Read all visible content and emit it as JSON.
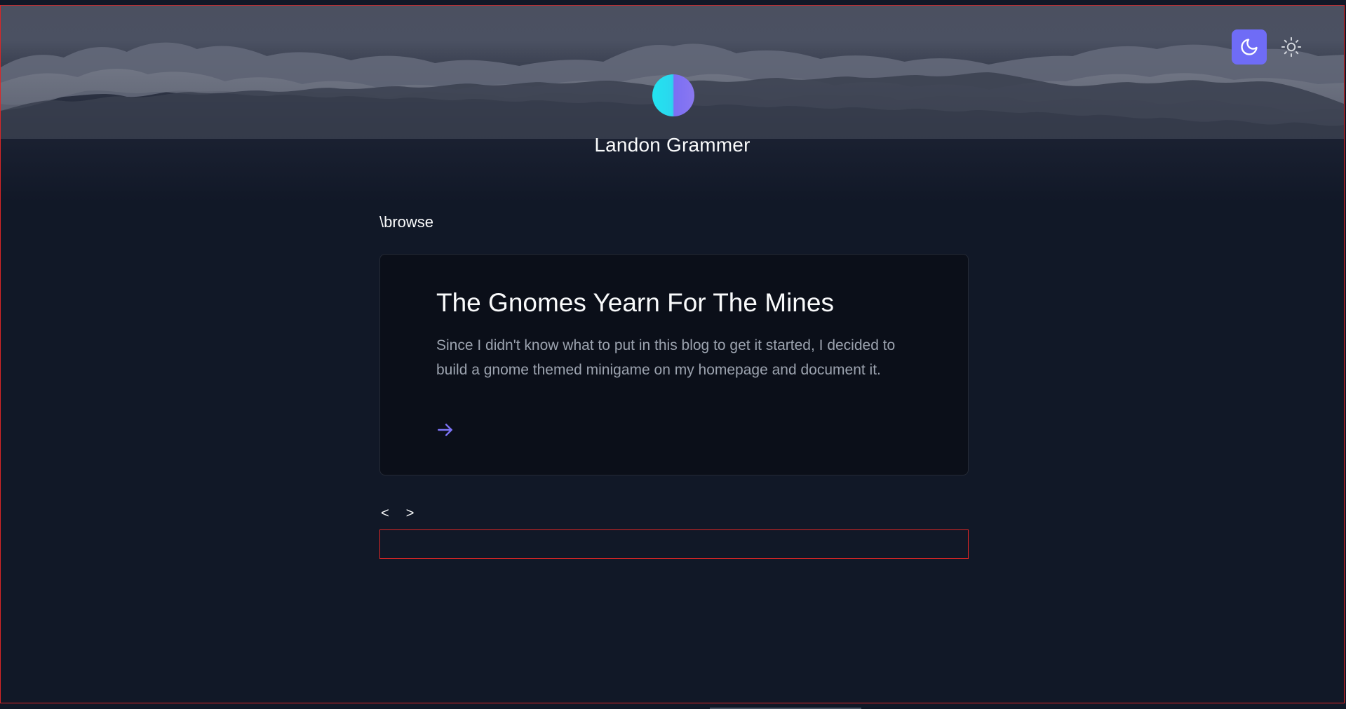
{
  "header": {
    "site_name": "Landon Grammer"
  },
  "theme_toggle": {
    "active": "dark",
    "dark_icon": "moon-icon",
    "light_icon": "sun-icon",
    "accent_color": "#6f6cf6"
  },
  "main": {
    "section_label": "\\browse",
    "posts": [
      {
        "title": "The Gnomes Yearn For The Mines",
        "description": "Since I didn't know what to put in this blog to get it started, I decided to build a gnome themed minigame on my homepage and document it.",
        "link_icon": "arrow-right-icon"
      }
    ],
    "pagination": {
      "prev_label": "<",
      "next_label": ">"
    }
  }
}
